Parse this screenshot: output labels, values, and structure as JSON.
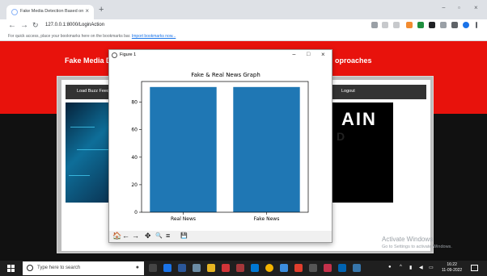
{
  "browser": {
    "tab_title": "Fake Media Detection Based on",
    "tab_close": "×",
    "new_tab": "+",
    "win_min": "−",
    "win_max": "▫",
    "win_close": "×",
    "url": "127.0.0.1:8000/LoginAction",
    "back": "←",
    "forward": "→",
    "reload": "↻",
    "bookmarks_msg": "For quick access, place your bookmarks here on the bookmarks bar.",
    "bookmarks_link": "Import bookmarks now..."
  },
  "page": {
    "banner_left": "Fake Media D",
    "banner_right": "oproaches",
    "nav_left": "Load Buzz Feed",
    "nav_right": "Logout",
    "image_right_text": "AIN",
    "image_right_sub": "D",
    "activate_title": "Activate Windows",
    "activate_sub": "Go to Settings to activate Windows."
  },
  "figure": {
    "window_title": "Figure 1",
    "ctl_min": "−",
    "ctl_max": "□",
    "ctl_close": "×",
    "toolbar": [
      "🏠",
      "←",
      "→",
      "✥",
      "🔍",
      "≡",
      "💾"
    ]
  },
  "chart_data": {
    "type": "bar",
    "title": "Fake & Real News Graph",
    "categories": [
      "Real News",
      "Fake News"
    ],
    "values": [
      91,
      91
    ],
    "xlabel": "",
    "ylabel": "",
    "ylim": [
      0,
      95
    ],
    "yticks": [
      0,
      20,
      40,
      60,
      80
    ],
    "bar_color": "#1f77b4",
    "grid": false
  },
  "taskbar": {
    "search_placeholder": "Type here to search",
    "time": "16:22",
    "date": "11-09-2022",
    "tray_arrow": "^"
  },
  "colors": {
    "banner_red": "#e8120c",
    "nav_dark": "#333333",
    "taskbar": "#1f1f1f"
  }
}
